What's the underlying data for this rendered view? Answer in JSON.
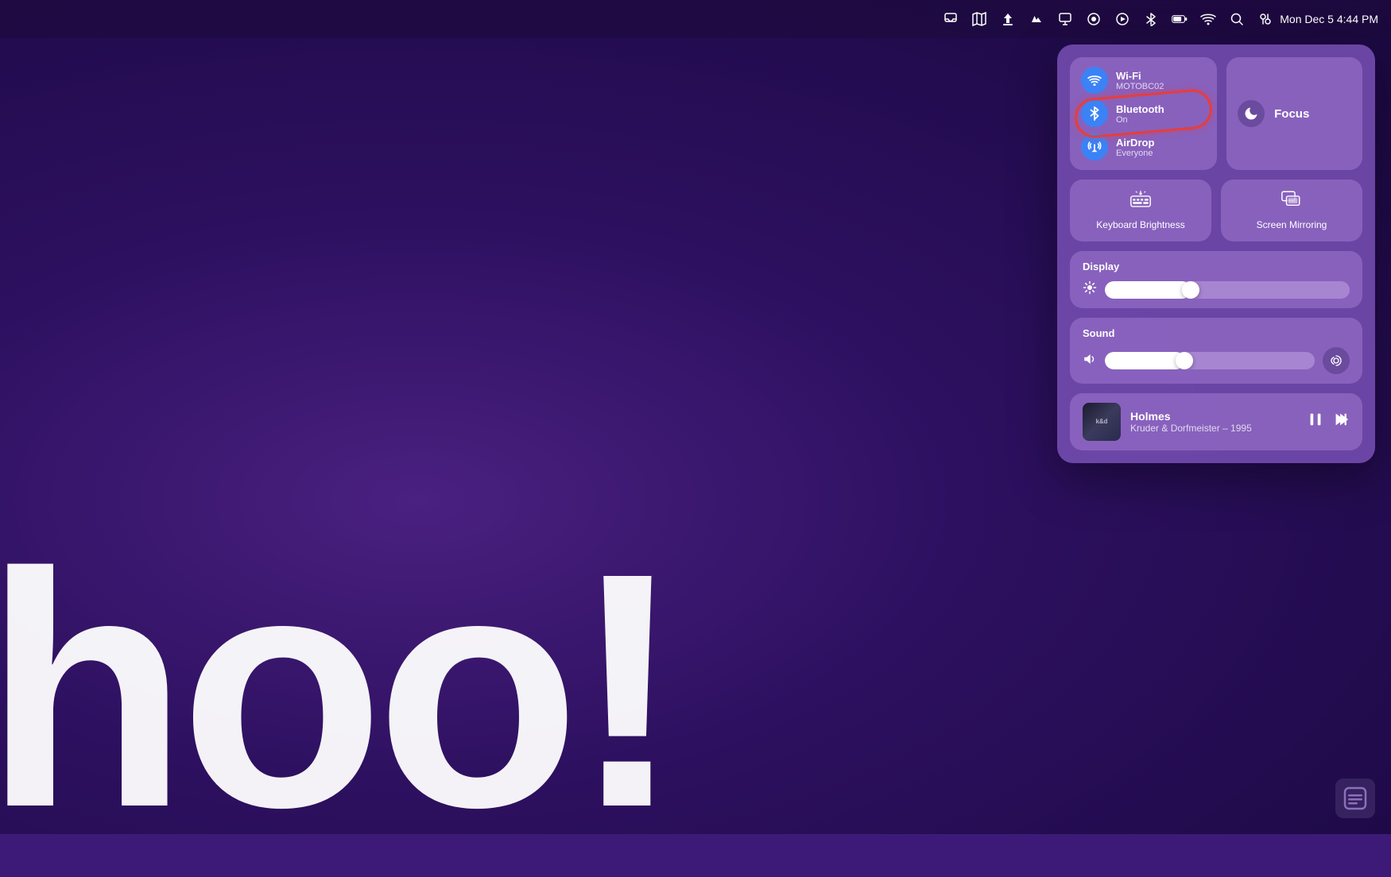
{
  "menubar": {
    "time": "Mon Dec 5  4:44 PM",
    "icons": [
      {
        "name": "inbox-icon",
        "symbol": "⊡"
      },
      {
        "name": "maps-icon",
        "symbol": "🗺"
      },
      {
        "name": "cloud-icon",
        "symbol": "▲"
      },
      {
        "name": "creative-cloud-icon",
        "symbol": "∞"
      },
      {
        "name": "screen-icon",
        "symbol": "▭"
      },
      {
        "name": "podcast-icon",
        "symbol": "⏺"
      },
      {
        "name": "plex-icon",
        "symbol": "▶"
      },
      {
        "name": "bluetooth-menubar-icon",
        "symbol": "✦"
      },
      {
        "name": "battery-icon",
        "symbol": "▮"
      },
      {
        "name": "wifi-menubar-icon",
        "symbol": "≋"
      },
      {
        "name": "search-icon",
        "symbol": "⌕"
      },
      {
        "name": "control-center-icon",
        "symbol": "⊞"
      }
    ]
  },
  "control_center": {
    "network": {
      "wifi": {
        "label": "Wi-Fi",
        "sub": "MOTOBC02"
      },
      "bluetooth": {
        "label": "Bluetooth",
        "sub": "On",
        "highlighted": true
      },
      "airdrop": {
        "label": "AirDrop",
        "sub": "Everyone"
      }
    },
    "focus": {
      "label": "Focus"
    },
    "keyboard_brightness": {
      "label": "Keyboard\nBrightness"
    },
    "screen_mirroring": {
      "label": "Screen\nMirroring"
    },
    "display": {
      "label": "Display",
      "value": 35
    },
    "sound": {
      "label": "Sound",
      "value": 38
    },
    "now_playing": {
      "track": "Holmes",
      "artist": "Kruder & Dorfmeister – 1995",
      "album_text": "k&d"
    }
  },
  "big_text": "hoo!",
  "bottom_right": {
    "symbol": "⊟"
  }
}
